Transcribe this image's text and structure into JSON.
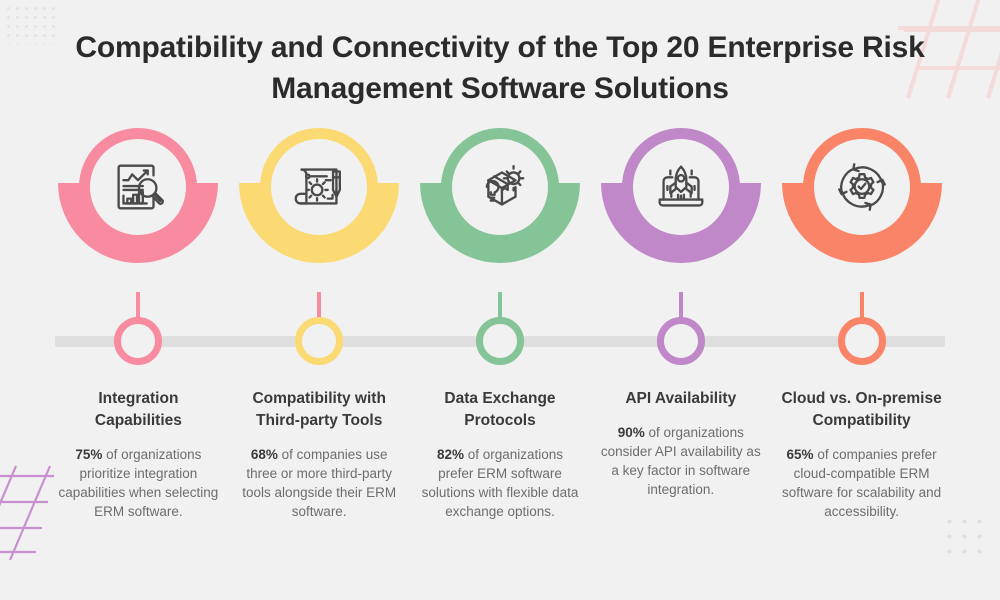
{
  "title": "Compatibility and Connectivity of the Top 20 Enterprise Risk Management Software Solutions",
  "theme": {
    "background": "#f1f1f1",
    "timeline_bar": "#dedede",
    "heading_color": "#3a3a3a",
    "body_color": "#6d6d6d",
    "deco_grid_tr_color": "#f4dad8",
    "deco_grid_bl_color": "#c98fd0",
    "deco_dot_color": "#e0e0e0"
  },
  "items": [
    {
      "id": "integration-capabilities",
      "heading": "Integration Capabilities",
      "stat": "75%",
      "body": " of organizations prioritize integration capabilities when selecting ERM software.",
      "color": "#f98ba0",
      "semi_color": "#f98ba0",
      "stem_color": "#f98ba0",
      "icon": "report-analysis-icon"
    },
    {
      "id": "compatibility-third-party-tools",
      "heading": "Compatibility with Third-party Tools",
      "stat": "68%",
      "body": " of companies use three or more third-party tools alongside their ERM software.",
      "color": "#fbda73",
      "semi_color": "#fbda73",
      "stem_color": "#f98ba0",
      "icon": "blueprint-gear-pencil-icon"
    },
    {
      "id": "data-exchange-protocols",
      "heading": "Data Exchange Protocols",
      "stat": "82%",
      "body": " of organizations prefer ERM software solutions with flexible data exchange options.",
      "color": "#85c496",
      "semi_color": "#85c496",
      "stem_color": "#85c496",
      "icon": "package-gear-bulb-icon"
    },
    {
      "id": "api-availability",
      "heading": "API Availability",
      "stat": "90%",
      "body": " of organizations consider API availability as a key factor in software integration.",
      "color": "#c087c9",
      "semi_color": "#c087c9",
      "stem_color": "#c087c9",
      "icon": "laptop-rocket-icon"
    },
    {
      "id": "cloud-vs-onpremise-compatibility",
      "heading": "Cloud vs. On-premise Compatibility",
      "stat": "65%",
      "body": " of companies prefer cloud-compatible ERM software for scalability and accessibility.",
      "color": "#fa8468",
      "semi_color": "#fa8468",
      "stem_color": "#fa8468",
      "icon": "gear-check-refresh-icon"
    }
  ]
}
